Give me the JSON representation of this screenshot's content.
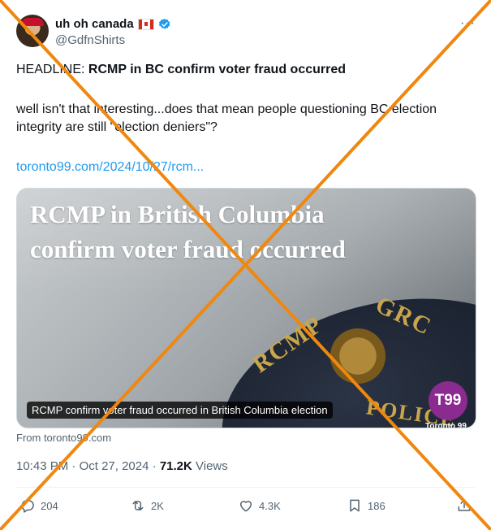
{
  "author": {
    "display_name": "uh oh canada",
    "handle": "@GdfnShirts",
    "flag_icon": "canada-flag-icon",
    "verified_icon": "verified-badge-icon",
    "verified_color": "#1d9bf0"
  },
  "menu": {
    "more_label": "···"
  },
  "post": {
    "headline_prefix": "HEADLINE: ",
    "headline_bold": "RCMP in BC confirm voter fraud occurred",
    "body": "well isn't that interesting...does that mean people questioning BC election integrity are still \"election deniers\"?",
    "link_text": "toronto99.com/2024/10/27/rcm..."
  },
  "card": {
    "title_line1": "RCMP in British Columbia",
    "title_line2": "confirm voter fraud occurred",
    "caption": "RCMP confirm voter fraud occurred in British Columbia election",
    "logo_text": "T99",
    "logo_subtext": "Toronto 99",
    "patch_words": [
      "RCMP",
      "GRC",
      "POLICE"
    ],
    "from_text": "From toronto99.com"
  },
  "meta": {
    "time": "10:43 PM",
    "separator": " · ",
    "date": "Oct 27, 2024",
    "views_count": "71.2K",
    "views_label": " Views"
  },
  "actions": {
    "replies": "204",
    "reposts": "2K",
    "likes": "4.3K",
    "bookmarks": "186"
  },
  "overlay": {
    "color": "#f0870f",
    "description_icon": "orange-x-cross"
  }
}
